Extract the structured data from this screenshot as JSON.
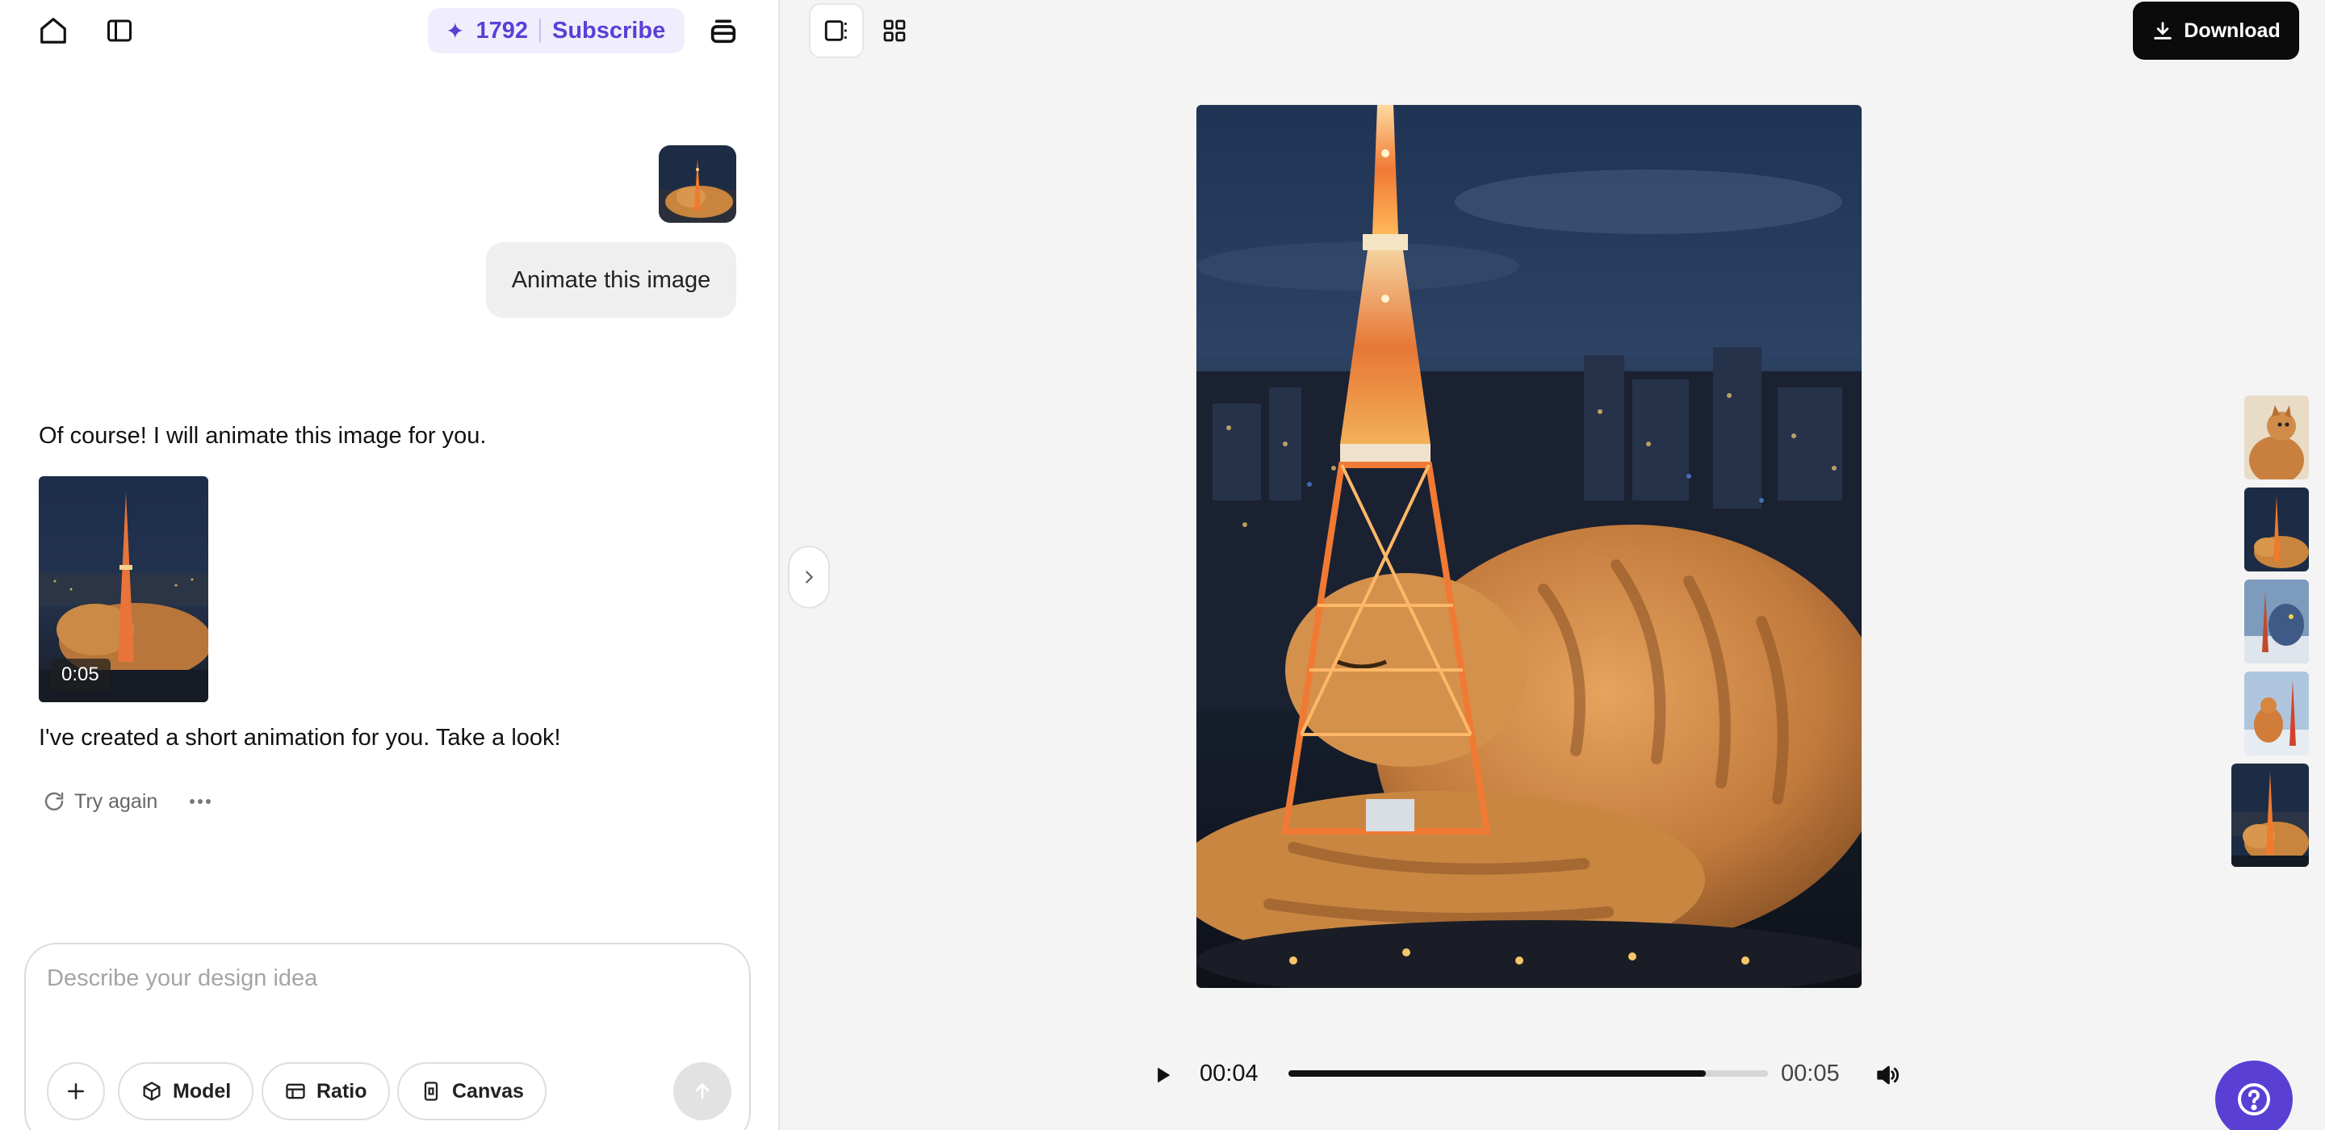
{
  "header": {
    "home_icon": "home-icon",
    "sidebar_icon": "sidebar-toggle-icon",
    "credits": "1792",
    "subscribe_label": "Subscribe",
    "layers_icon": "layers-icon",
    "accent_color": "#5b3fd6"
  },
  "chat": {
    "user_message": "Animate this image",
    "assistant_intro": "Of course! I will animate this image for you.",
    "video_duration": "0:05",
    "assistant_followup": "I've created a short animation for you. Take a look!",
    "try_again_label": "Try again"
  },
  "composer": {
    "placeholder": "Describe your design idea",
    "model_label": "Model",
    "ratio_label": "Ratio",
    "canvas_label": "Canvas"
  },
  "preview": {
    "download_label": "Download",
    "current_time": "00:04",
    "total_time": "00:05",
    "progress_fraction": 0.87
  },
  "thumbnails": [
    {
      "subject": "cat-portrait",
      "active": false
    },
    {
      "subject": "cat-tower-night",
      "active": false
    },
    {
      "subject": "bird-tower",
      "active": false
    },
    {
      "subject": "cat-tower-day",
      "active": false
    },
    {
      "subject": "cat-tower-night",
      "active": true
    }
  ]
}
